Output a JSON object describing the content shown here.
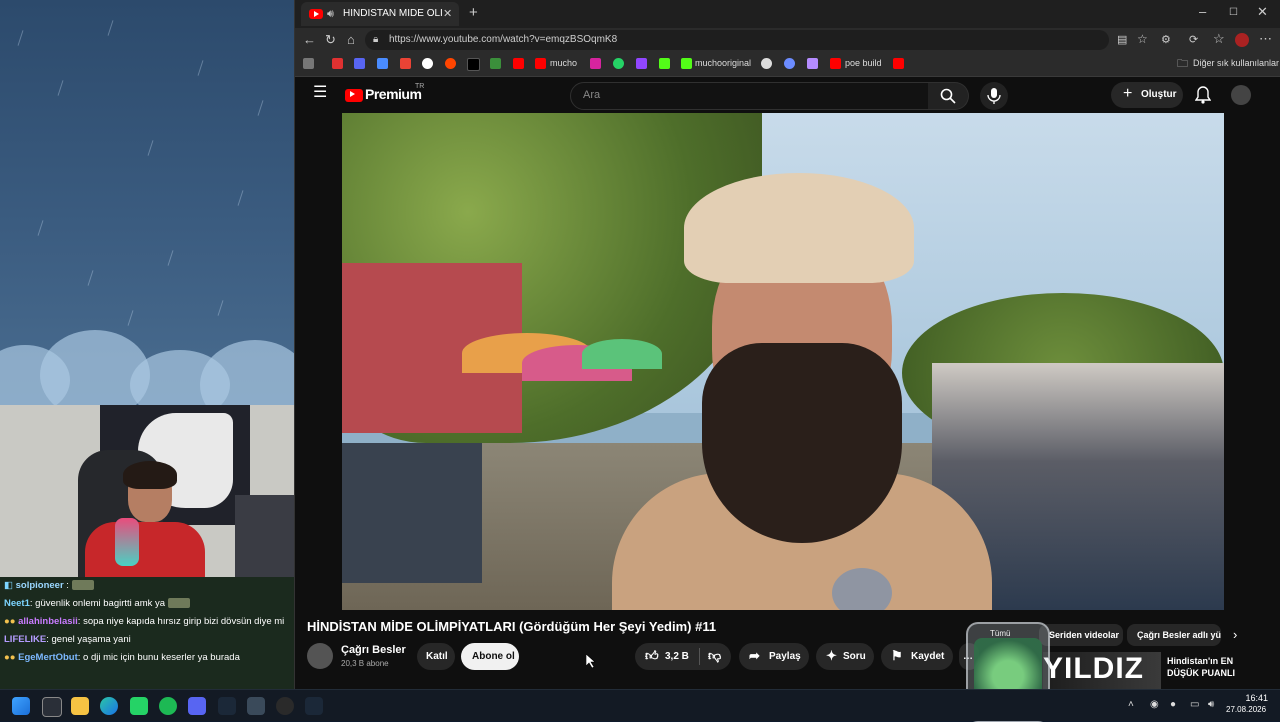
{
  "browser": {
    "tab_title": "HİNDİSTAN MİDE OLİMPİYATL",
    "url": "https://www.youtube.com/watch?v=emqzBSOqmK8",
    "bookmarks": [
      "mucho",
      "muchooriginal",
      "poe build"
    ],
    "other_bookmarks": "Diğer sık kullanılanlar"
  },
  "youtube": {
    "logo_text": "Premium",
    "logo_region": "TR",
    "search_placeholder": "Ara",
    "create_label": "Oluştur",
    "video_title": "HİNDİSTAN MİDE OLİMPİYATLARI (Gördüğüm Her Şeyi Yedim) #11",
    "channel_name": "Çağrı Besler",
    "channel_subs": "20,3 B abone",
    "join_label": "Katıl",
    "subscribe_label": "Abone ol",
    "like_count": "3,2 B",
    "share_label": "Paylaş",
    "ask_label": "Soru",
    "save_label": "Kaydet",
    "chips": [
      "Tümü",
      "Seriden videolar",
      "Çağrı Besler adlı yük"
    ],
    "rec_thumb_text": "YILDIZ",
    "rec_title": "Hindistan'ın EN DÜŞÜK PUANLI"
  },
  "chat": [
    {
      "name": "solpioneer",
      "text": "",
      "color": "#9ad7ff"
    },
    {
      "name": "Neet1",
      "text": "güvenlik onlemi bagirtti amk ya",
      "color": "#7cd4ff"
    },
    {
      "name": "allahinbelasii",
      "text": "sopa niye kapıda hırsız girip bizi dövsün diye mi",
      "color": "#c97cff"
    },
    {
      "name": "LIFELIKE",
      "text": "genel yaşama yani",
      "color": "#b49cff"
    },
    {
      "name": "EgeMertObut",
      "text": "o dji mic için bunu keserler ya burada",
      "color": "#7cb8ff"
    }
  ],
  "taskbar": {
    "time": "16:41",
    "date": "27.08.2026"
  }
}
